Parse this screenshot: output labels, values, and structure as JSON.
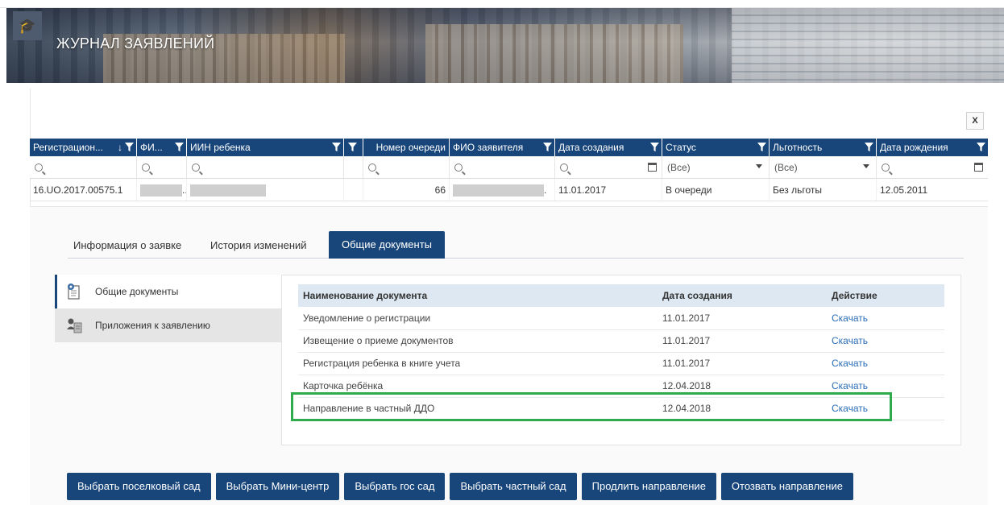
{
  "header": {
    "title": "ЖУРНАЛ ЗАЯВЛЕНИЙ",
    "logo_glyph": "🎓"
  },
  "toolbar": {
    "export_glyph": "X"
  },
  "grid": {
    "columns": [
      {
        "label": "Регистрацион...",
        "sort": "↓"
      },
      {
        "label": "ФИ..."
      },
      {
        "label": "ИИН ребенка"
      },
      {
        "label": ""
      },
      {
        "label": "Номер очереди"
      },
      {
        "label": "ФИО заявителя"
      },
      {
        "label": "Дата создания"
      },
      {
        "label": "Статус"
      },
      {
        "label": "Льготность"
      },
      {
        "label": "Дата рождения"
      }
    ],
    "filters": {
      "status": "(Все)",
      "benefit": "(Все)"
    },
    "row": {
      "reg_number": "16.UO.2017.00575.1",
      "fio_suffix": "..",
      "queue_number": "66",
      "applicant_suffix": ".",
      "created": "11.01.2017",
      "status": "В очереди",
      "benefit": "Без льготы",
      "birth_date": "12.05.2011"
    }
  },
  "tabs": [
    {
      "label": "Информация о заявке"
    },
    {
      "label": "История изменений"
    },
    {
      "label": "Общие документы",
      "active": true
    }
  ],
  "side_menu": [
    {
      "label": "Общие документы",
      "icon": "documents-gear-icon",
      "active": true
    },
    {
      "label": "Приложения к заявлению",
      "icon": "user-document-icon"
    }
  ],
  "documents": {
    "headers": {
      "name": "Наименование документа",
      "date": "Дата создания",
      "action": "Действие"
    },
    "rows": [
      {
        "name": "Уведомление о регистрации",
        "date": "11.01.2017",
        "action": "Скачать"
      },
      {
        "name": "Извещение о приеме документов",
        "date": "11.01.2017",
        "action": "Скачать"
      },
      {
        "name": "Регистрация ребенка в книге учета",
        "date": "11.01.2017",
        "action": "Скачать"
      },
      {
        "name": "Карточка ребёнка",
        "date": "12.04.2018",
        "action": "Скачать"
      },
      {
        "name": "Направление в частный ДДО",
        "date": "12.04.2018",
        "action": "Скачать"
      }
    ],
    "highlight_color": "#2eab4c"
  },
  "actions": [
    {
      "label": "Выбрать поселковый сад"
    },
    {
      "label": "Выбрать Мини-центр"
    },
    {
      "label": "Выбрать гос сад"
    },
    {
      "label": "Выбрать частный сад"
    },
    {
      "label": "Продлить направление"
    },
    {
      "label": "Отозвать направление"
    }
  ],
  "colors": {
    "primary": "#18467b",
    "link": "#2a6db6",
    "header_bg": "#dde8f2"
  }
}
